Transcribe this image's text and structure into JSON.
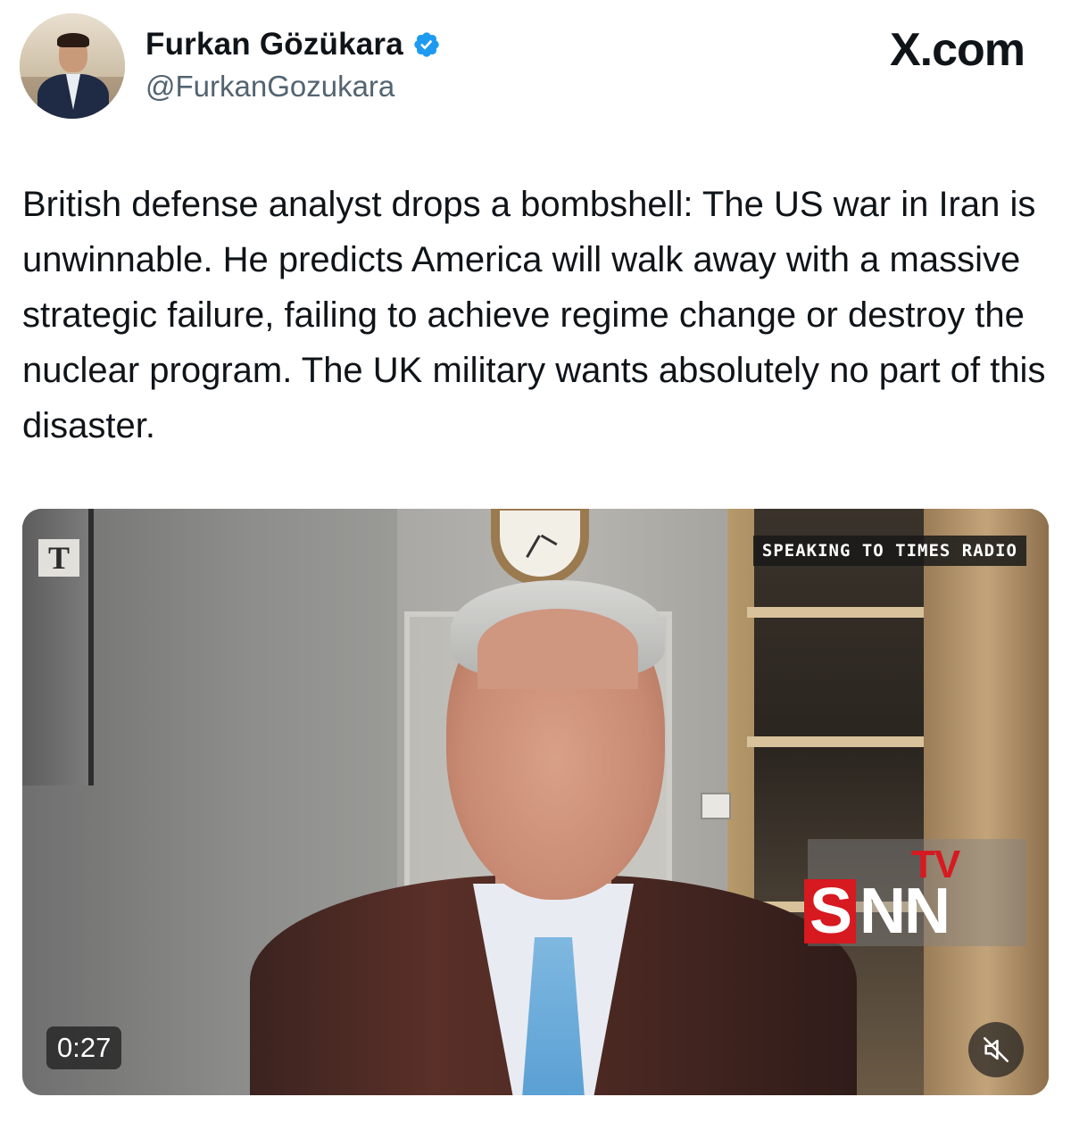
{
  "header": {
    "display_name": "Furkan Gözükara",
    "handle": "@FurkanGozukara",
    "verified_icon": "verified-badge-icon",
    "brand": "X.com",
    "accent_color": "#1d9bf0"
  },
  "tweet": {
    "text": "British defense analyst drops a bombshell: The US war in Iran is unwinnable. He predicts America will walk away with a massive strategic failure, failing to achieve regime change or destroy the nuclear program. The UK military wants absolutely no part of this disaster."
  },
  "video": {
    "times_logo": "T",
    "caption": "SPEAKING TO TIMES RADIO",
    "watermark_tv": "TV",
    "watermark_s": "S",
    "watermark_nn": "NN",
    "duration": "0:27",
    "mute_icon": "muted-speaker-icon"
  }
}
